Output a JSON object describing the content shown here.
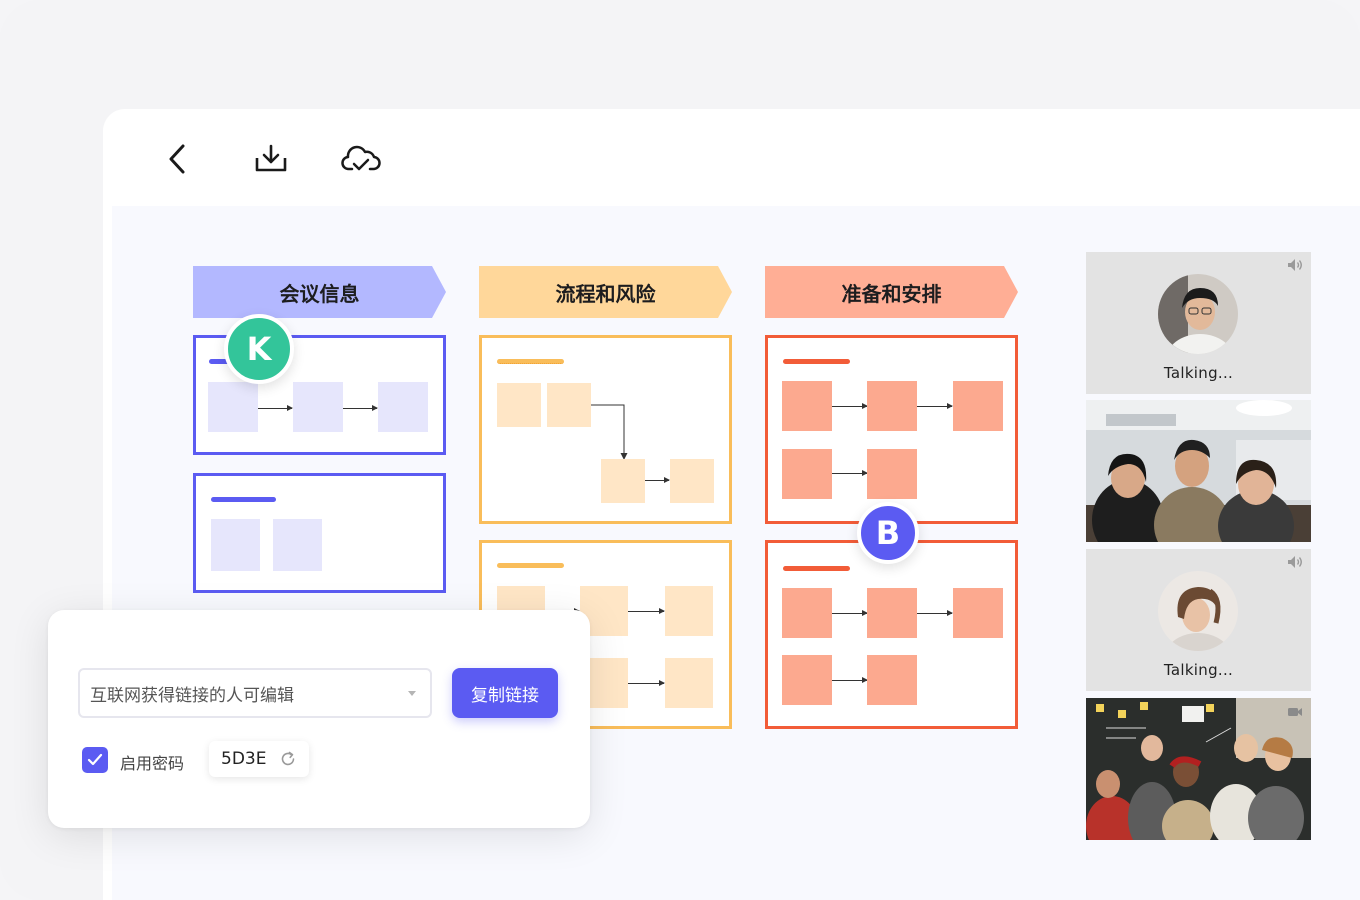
{
  "toolbar": {
    "back_icon": "chevron-left-icon",
    "download_icon": "download-icon",
    "cloud_icon": "cloud-check-icon"
  },
  "board": {
    "columns": [
      {
        "title": "会议信息",
        "color": "#b3b8ff",
        "frame_color": "#5b5bf2",
        "block_color": "#e6e6fc"
      },
      {
        "title": "流程和风险",
        "color": "#ffd79a",
        "frame_color": "#f9bd5a",
        "block_color": "#ffe6c6"
      },
      {
        "title": "准备和安排",
        "color": "#ffae95",
        "frame_color": "#f25c38",
        "block_color": "#fca98f"
      }
    ]
  },
  "collaborators": [
    {
      "initial": "K",
      "color": "#33c59a"
    },
    {
      "initial": "B",
      "color": "#5b5bf2"
    }
  ],
  "video_tiles": [
    {
      "label": "Talking...",
      "type": "avatar"
    },
    {
      "label": "",
      "type": "video"
    },
    {
      "label": "Talking...",
      "type": "avatar"
    },
    {
      "label": "",
      "type": "video"
    }
  ],
  "share": {
    "permission_value": "互联网获得链接的人可编辑",
    "copy_button": "复制链接",
    "password_checkbox_label": "启用密码",
    "password_checked": true,
    "password_value": "5D3E"
  },
  "colors": {
    "accent": "#5b5bf2"
  }
}
